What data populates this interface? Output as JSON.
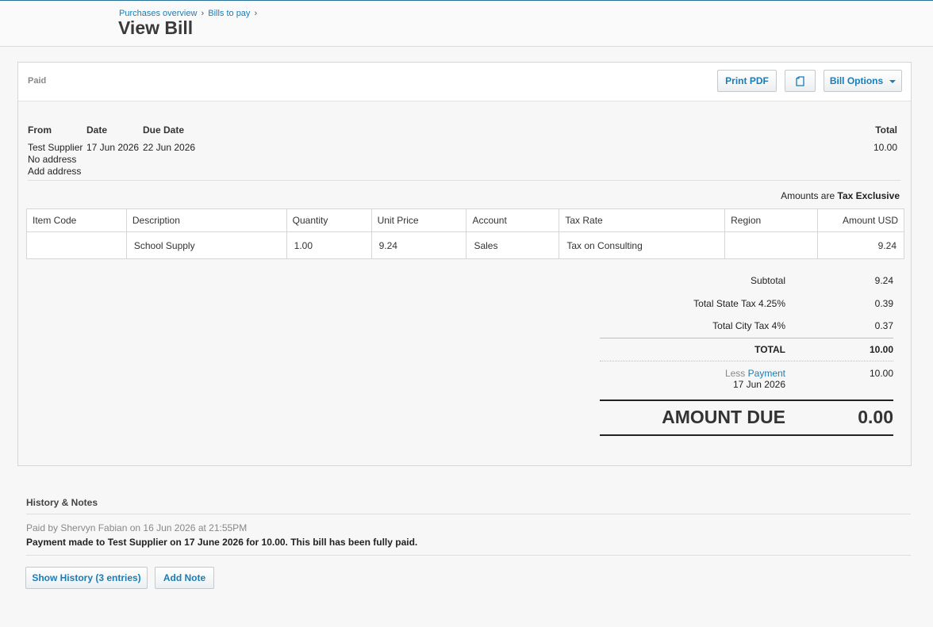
{
  "breadcrumb": {
    "items": [
      "Purchases overview",
      "Bills to pay"
    ],
    "separator": "›"
  },
  "page": {
    "title": "View Bill"
  },
  "bill": {
    "status": "Paid",
    "actions": {
      "print_pdf": "Print PDF",
      "copy_icon": "document-icon",
      "options": "Bill Options"
    },
    "from_label": "From",
    "date_label": "Date",
    "due_label": "Due Date",
    "total_label": "Total",
    "supplier": "Test Supplier",
    "address": "No address",
    "add_address": "Add address",
    "date": "17 Jun 2026",
    "due_date": "22 Jun 2026",
    "total": "10.00",
    "amounts_prefix": "Amounts are",
    "amounts_mode": "Tax Exclusive"
  },
  "table": {
    "headers": [
      "Item Code",
      "Description",
      "Quantity",
      "Unit Price",
      "Account",
      "Tax Rate",
      "Region",
      "Amount USD"
    ],
    "rows": [
      {
        "item_code": "",
        "description": "School Supply",
        "quantity": "1.00",
        "unit_price": "9.24",
        "account": "Sales",
        "tax_rate": "Tax on Consulting",
        "region": "",
        "amount": "9.24"
      }
    ]
  },
  "totals": {
    "subtotal_label": "Subtotal",
    "subtotal": "9.24",
    "state_tax_label": "Total State Tax 4.25%",
    "state_tax": "0.39",
    "city_tax_label": "Total City Tax 4%",
    "city_tax": "0.37",
    "total_label": "TOTAL",
    "total": "10.00",
    "less_label": "Less",
    "payment_label": "Payment",
    "payment_date": "17 Jun 2026",
    "payment": "10.00",
    "amount_due_label": "AMOUNT DUE",
    "amount_due": "0.00"
  },
  "history": {
    "title": "History & Notes",
    "meta": "Paid by Shervyn Fabian on 16 Jun 2026 at 21:55PM",
    "text": "Payment made to Test Supplier on 17 June 2026 for 10.00. This bill has been fully paid.",
    "show_history": "Show History (3 entries)",
    "add_note": "Add Note"
  }
}
